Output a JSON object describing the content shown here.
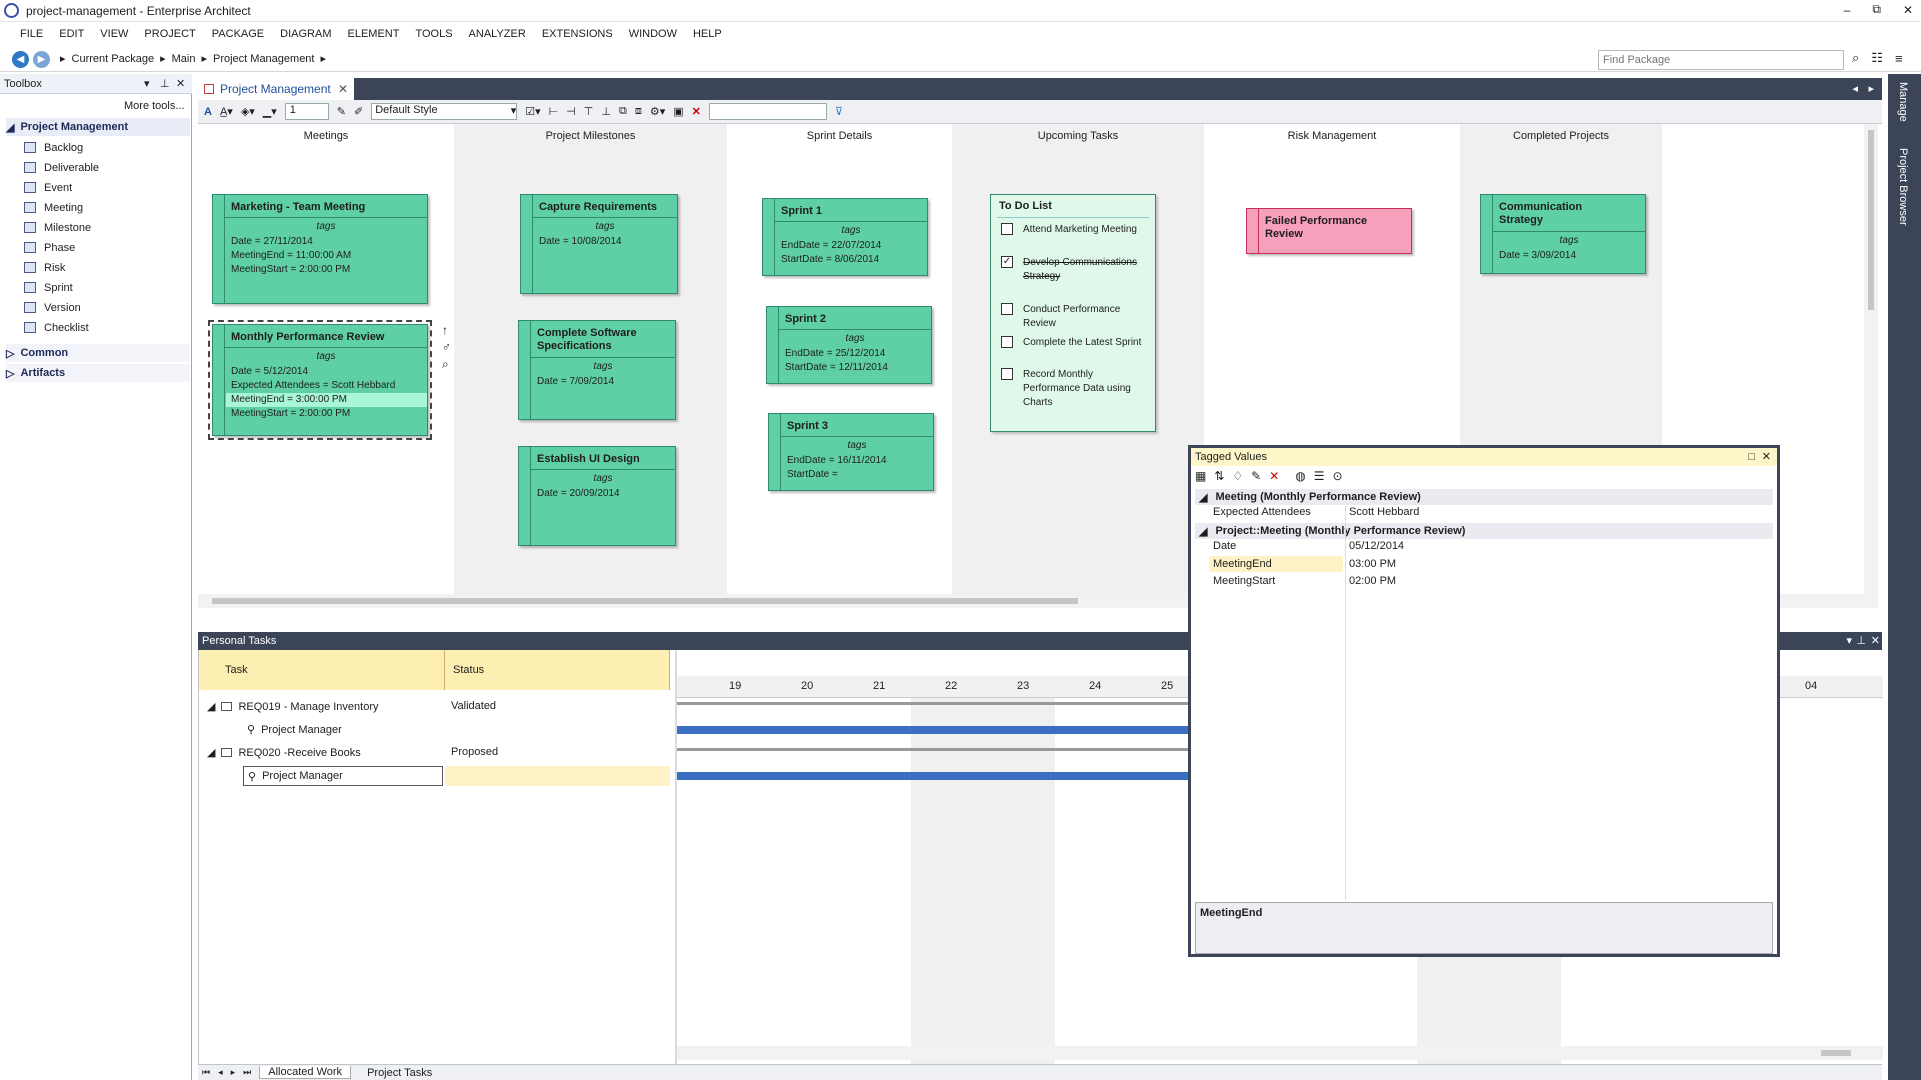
{
  "window": {
    "title": "project-management - Enterprise Architect"
  },
  "menu": [
    "FILE",
    "EDIT",
    "VIEW",
    "PROJECT",
    "PACKAGE",
    "DIAGRAM",
    "ELEMENT",
    "TOOLS",
    "ANALYZER",
    "EXTENSIONS",
    "WINDOW",
    "HELP"
  ],
  "breadcrumb": [
    "Current Package",
    "Main",
    "Project Management"
  ],
  "search": {
    "placeholder": "Find Package"
  },
  "toolbox": {
    "title": "Toolbox",
    "more": "More tools...",
    "group": "Project Management",
    "items": [
      "Backlog",
      "Deliverable",
      "Event",
      "Meeting",
      "Milestone",
      "Phase",
      "Risk",
      "Sprint",
      "Version",
      "Checklist"
    ],
    "groups": [
      "Common",
      "Artifacts"
    ]
  },
  "diagram": {
    "tab": "Project Management",
    "style": "Default Style",
    "zoom": "1",
    "lanes": [
      "Meetings",
      "Project Milestones",
      "Sprint Details",
      "Upcoming Tasks",
      "Risk Management",
      "Completed Projects"
    ],
    "elements": {
      "m1": {
        "name": "Marketing - Team Meeting",
        "tags": "tags",
        "vals": [
          "Date = 27/11/2014",
          "MeetingEnd = 11:00:00 AM",
          "MeetingStart = 2:00:00 PM"
        ]
      },
      "m2": {
        "name": "Monthly Performance Review",
        "tags": "tags",
        "vals": [
          "Date = 5/12/2014",
          "Expected Attendees = Scott Hebbard",
          "MeetingEnd = 3:00:00 PM",
          "MeetingStart = 2:00:00 PM"
        ]
      },
      "p1": {
        "name": "Capture Requirements",
        "tags": "tags",
        "vals": [
          "Date = 10/08/2014"
        ]
      },
      "p2": {
        "name": "Complete Software Specifications",
        "tags": "tags",
        "vals": [
          "Date = 7/09/2014"
        ]
      },
      "p3": {
        "name": "Establish UI Design",
        "tags": "tags",
        "vals": [
          "Date = 20/09/2014"
        ]
      },
      "s1": {
        "name": "Sprint 1",
        "tags": "tags",
        "vals": [
          "EndDate = 22/07/2014",
          "StartDate = 8/06/2014"
        ]
      },
      "s2": {
        "name": "Sprint 2",
        "tags": "tags",
        "vals": [
          "EndDate = 25/12/2014",
          "StartDate = 12/11/2014"
        ]
      },
      "s3": {
        "name": "Sprint 3",
        "tags": "tags",
        "vals": [
          "EndDate = 16/11/2014",
          "StartDate ="
        ]
      },
      "risk": {
        "name": "Failed Performance Review"
      },
      "c1": {
        "name": "Communication Strategy",
        "tags": "tags",
        "vals": [
          "Date = 3/09/2014"
        ]
      }
    },
    "todo": {
      "title": "To Do List",
      "items": [
        {
          "text": "Attend Marketing Meeting",
          "done": false
        },
        {
          "text": "Develop Communications Strategy",
          "done": true
        },
        {
          "text": "Conduct Performance Review",
          "done": false
        },
        {
          "text": "Complete the Latest Sprint",
          "done": false
        },
        {
          "text": "Record Monthly Performance Data using Charts",
          "done": false
        }
      ]
    }
  },
  "personal_tasks": {
    "title": "Personal Tasks",
    "cols": [
      "Task",
      "Status"
    ],
    "rows": [
      {
        "task": "REQ019 - Manage Inventory",
        "status": "Validated",
        "child": "Project Manager"
      },
      {
        "task": "REQ020 -Receive Books",
        "status": "Proposed",
        "child": "Project Manager"
      }
    ],
    "days": [
      "19",
      "20",
      "21",
      "22",
      "23",
      "24",
      "25",
      "04"
    ],
    "tabs": [
      "Allocated Work",
      "Project Tasks"
    ]
  },
  "tagged_values": {
    "title": "Tagged Values",
    "groups": [
      {
        "name": "Meeting (Monthly Performance Review)",
        "rows": [
          [
            "Expected Attendees",
            "Scott Hebbard"
          ]
        ]
      },
      {
        "name": "Project::Meeting (Monthly Performance Review)",
        "rows": [
          [
            "Date",
            "05/12/2014"
          ],
          [
            "MeetingEnd",
            "03:00 PM"
          ],
          [
            "MeetingStart",
            "02:00 PM"
          ]
        ]
      }
    ],
    "note": "MeetingEnd"
  },
  "right_tabs": [
    "Manage",
    "Project Browser"
  ]
}
